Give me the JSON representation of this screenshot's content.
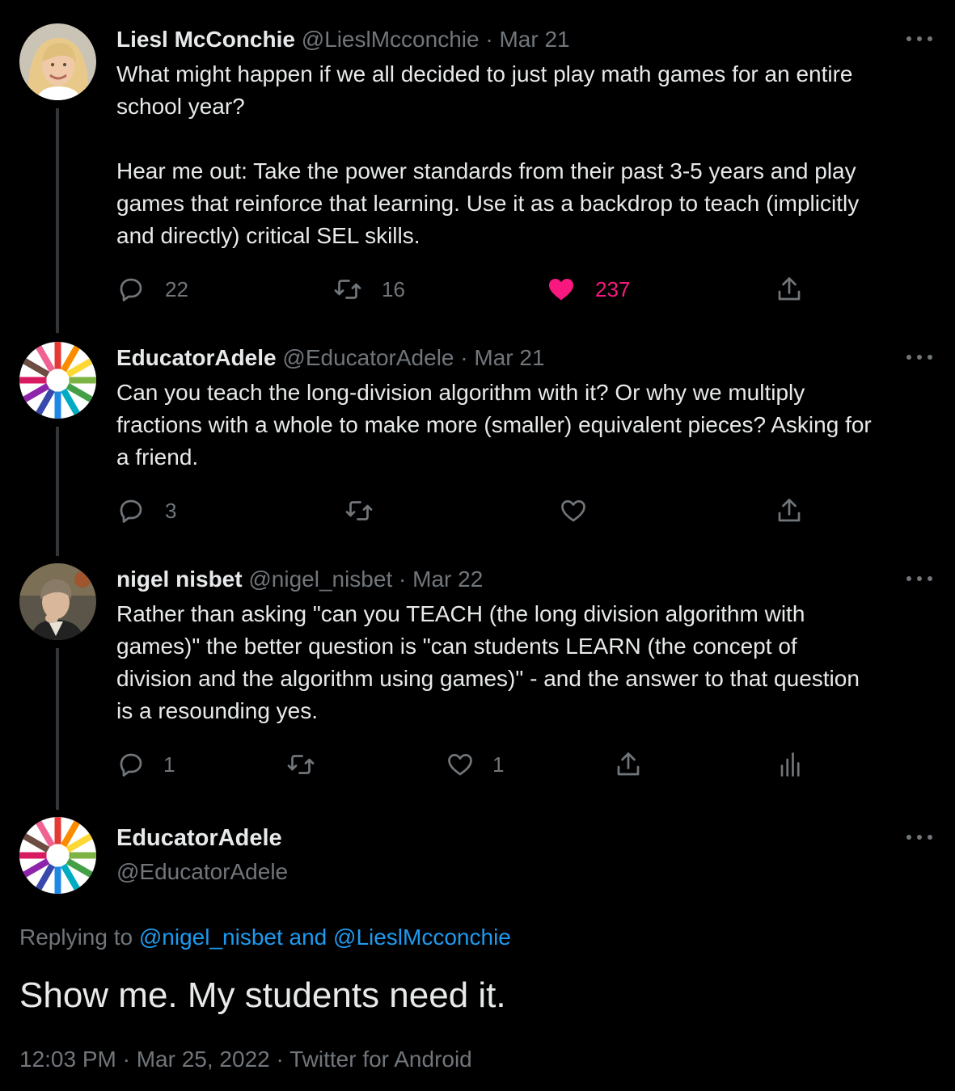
{
  "colors": {
    "background": "#000000",
    "text": "#e7e9ea",
    "muted": "#71767b",
    "link": "#1d9bf0",
    "like": "#f91880",
    "thread_line": "#333639"
  },
  "tweets": [
    {
      "name": "Liesl McConchie",
      "handle": "@LieslMcconchie",
      "separator": "·",
      "date": "Mar 21",
      "text": "What might happen if we all decided to just play math games for an entire\nschool year?\n\nHear me out: Take the power standards from their past 3-5 years and play\ngames that reinforce that learning. Use it as a backdrop to teach (implicitly\nand directly) critical SEL skills.",
      "replies": "22",
      "retweets": "16",
      "likes": "237",
      "liked": true,
      "icons": [
        "reply-icon",
        "retweet-icon",
        "heart-filled-icon",
        "share-icon"
      ]
    },
    {
      "name": "EducatorAdele",
      "handle": "@EducatorAdele",
      "separator": "·",
      "date": "Mar 21",
      "text": "Can you teach the long-division algorithm with it? Or why we multiply\nfractions with a whole to make more (smaller) equivalent pieces? Asking for\na friend.",
      "replies": "3",
      "retweets": "",
      "likes": "",
      "liked": false,
      "icons": [
        "reply-icon",
        "retweet-icon",
        "heart-icon",
        "share-icon"
      ]
    },
    {
      "name": "nigel nisbet",
      "handle": "@nigel_nisbet",
      "separator": "·",
      "date": "Mar 22",
      "text": "Rather than asking \"can you TEACH (the long division algorithm with\ngames)\" the better question is \"can students LEARN (the concept of\ndivision and the algorithm using games)\" - and the answer to that question\nis a resounding yes.",
      "replies": "1",
      "retweets": "",
      "likes": "1",
      "liked": false,
      "icons": [
        "reply-icon",
        "retweet-icon",
        "heart-icon",
        "share-icon",
        "analytics-icon"
      ]
    }
  ],
  "main_tweet": {
    "name": "EducatorAdele",
    "handle": "@EducatorAdele",
    "replying_prefix": "Replying to ",
    "replying_to": "@nigel_nisbet and @LieslMcconchie",
    "text": "Show me. My students need it.",
    "meta": "12:03 PM · Mar 25, 2022 · Twitter for Android"
  }
}
